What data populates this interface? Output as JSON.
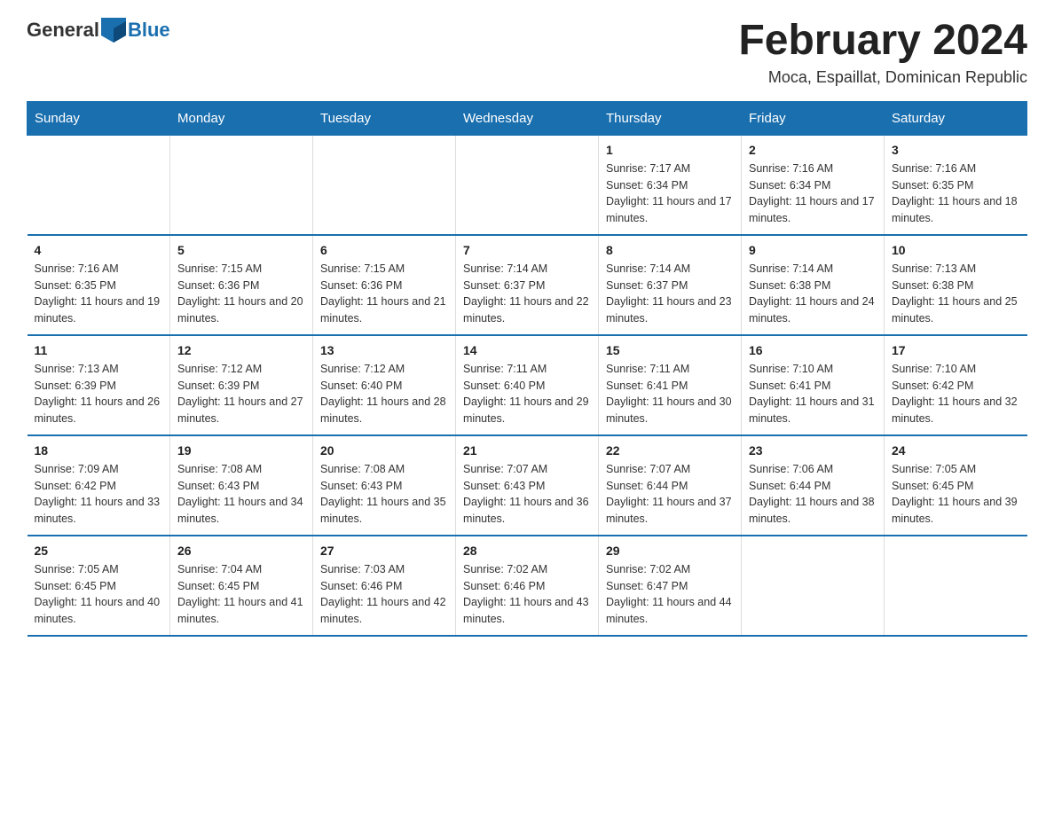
{
  "header": {
    "logo_general": "General",
    "logo_blue": "Blue",
    "title": "February 2024",
    "subtitle": "Moca, Espaillat, Dominican Republic"
  },
  "days_of_week": [
    "Sunday",
    "Monday",
    "Tuesday",
    "Wednesday",
    "Thursday",
    "Friday",
    "Saturday"
  ],
  "weeks": [
    [
      {
        "day": "",
        "info": ""
      },
      {
        "day": "",
        "info": ""
      },
      {
        "day": "",
        "info": ""
      },
      {
        "day": "",
        "info": ""
      },
      {
        "day": "1",
        "info": "Sunrise: 7:17 AM\nSunset: 6:34 PM\nDaylight: 11 hours and 17 minutes."
      },
      {
        "day": "2",
        "info": "Sunrise: 7:16 AM\nSunset: 6:34 PM\nDaylight: 11 hours and 17 minutes."
      },
      {
        "day": "3",
        "info": "Sunrise: 7:16 AM\nSunset: 6:35 PM\nDaylight: 11 hours and 18 minutes."
      }
    ],
    [
      {
        "day": "4",
        "info": "Sunrise: 7:16 AM\nSunset: 6:35 PM\nDaylight: 11 hours and 19 minutes."
      },
      {
        "day": "5",
        "info": "Sunrise: 7:15 AM\nSunset: 6:36 PM\nDaylight: 11 hours and 20 minutes."
      },
      {
        "day": "6",
        "info": "Sunrise: 7:15 AM\nSunset: 6:36 PM\nDaylight: 11 hours and 21 minutes."
      },
      {
        "day": "7",
        "info": "Sunrise: 7:14 AM\nSunset: 6:37 PM\nDaylight: 11 hours and 22 minutes."
      },
      {
        "day": "8",
        "info": "Sunrise: 7:14 AM\nSunset: 6:37 PM\nDaylight: 11 hours and 23 minutes."
      },
      {
        "day": "9",
        "info": "Sunrise: 7:14 AM\nSunset: 6:38 PM\nDaylight: 11 hours and 24 minutes."
      },
      {
        "day": "10",
        "info": "Sunrise: 7:13 AM\nSunset: 6:38 PM\nDaylight: 11 hours and 25 minutes."
      }
    ],
    [
      {
        "day": "11",
        "info": "Sunrise: 7:13 AM\nSunset: 6:39 PM\nDaylight: 11 hours and 26 minutes."
      },
      {
        "day": "12",
        "info": "Sunrise: 7:12 AM\nSunset: 6:39 PM\nDaylight: 11 hours and 27 minutes."
      },
      {
        "day": "13",
        "info": "Sunrise: 7:12 AM\nSunset: 6:40 PM\nDaylight: 11 hours and 28 minutes."
      },
      {
        "day": "14",
        "info": "Sunrise: 7:11 AM\nSunset: 6:40 PM\nDaylight: 11 hours and 29 minutes."
      },
      {
        "day": "15",
        "info": "Sunrise: 7:11 AM\nSunset: 6:41 PM\nDaylight: 11 hours and 30 minutes."
      },
      {
        "day": "16",
        "info": "Sunrise: 7:10 AM\nSunset: 6:41 PM\nDaylight: 11 hours and 31 minutes."
      },
      {
        "day": "17",
        "info": "Sunrise: 7:10 AM\nSunset: 6:42 PM\nDaylight: 11 hours and 32 minutes."
      }
    ],
    [
      {
        "day": "18",
        "info": "Sunrise: 7:09 AM\nSunset: 6:42 PM\nDaylight: 11 hours and 33 minutes."
      },
      {
        "day": "19",
        "info": "Sunrise: 7:08 AM\nSunset: 6:43 PM\nDaylight: 11 hours and 34 minutes."
      },
      {
        "day": "20",
        "info": "Sunrise: 7:08 AM\nSunset: 6:43 PM\nDaylight: 11 hours and 35 minutes."
      },
      {
        "day": "21",
        "info": "Sunrise: 7:07 AM\nSunset: 6:43 PM\nDaylight: 11 hours and 36 minutes."
      },
      {
        "day": "22",
        "info": "Sunrise: 7:07 AM\nSunset: 6:44 PM\nDaylight: 11 hours and 37 minutes."
      },
      {
        "day": "23",
        "info": "Sunrise: 7:06 AM\nSunset: 6:44 PM\nDaylight: 11 hours and 38 minutes."
      },
      {
        "day": "24",
        "info": "Sunrise: 7:05 AM\nSunset: 6:45 PM\nDaylight: 11 hours and 39 minutes."
      }
    ],
    [
      {
        "day": "25",
        "info": "Sunrise: 7:05 AM\nSunset: 6:45 PM\nDaylight: 11 hours and 40 minutes."
      },
      {
        "day": "26",
        "info": "Sunrise: 7:04 AM\nSunset: 6:45 PM\nDaylight: 11 hours and 41 minutes."
      },
      {
        "day": "27",
        "info": "Sunrise: 7:03 AM\nSunset: 6:46 PM\nDaylight: 11 hours and 42 minutes."
      },
      {
        "day": "28",
        "info": "Sunrise: 7:02 AM\nSunset: 6:46 PM\nDaylight: 11 hours and 43 minutes."
      },
      {
        "day": "29",
        "info": "Sunrise: 7:02 AM\nSunset: 6:47 PM\nDaylight: 11 hours and 44 minutes."
      },
      {
        "day": "",
        "info": ""
      },
      {
        "day": "",
        "info": ""
      }
    ]
  ]
}
